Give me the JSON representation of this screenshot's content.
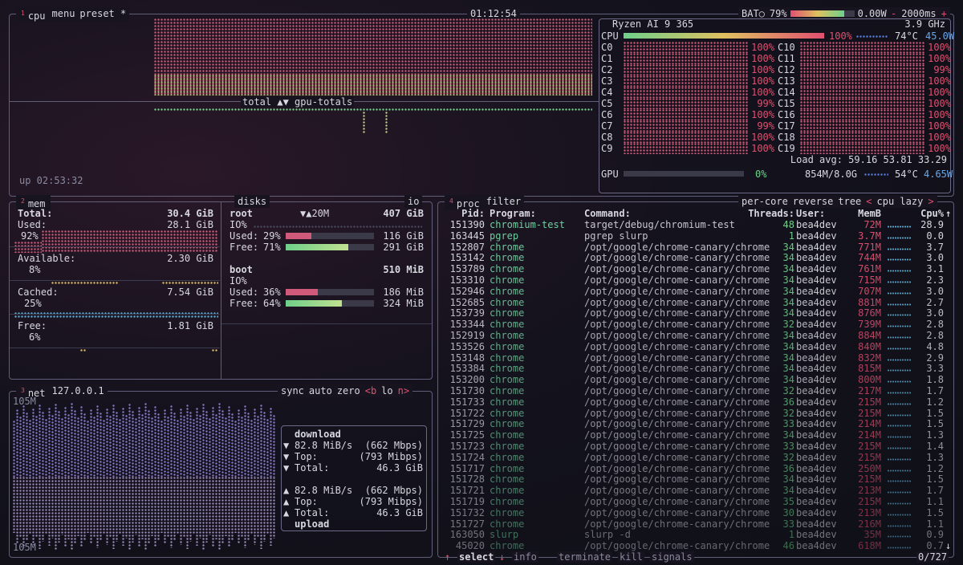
{
  "cpu": {
    "title": "cpu",
    "num": "1",
    "menu": "menu",
    "preset": "preset *",
    "clock": "01:12:54",
    "battery_label": "BAT○",
    "battery_pct": "79%",
    "battery_fraction": 0.79,
    "power": "0.00W",
    "refresh": "2000ms",
    "refresh_minus": "-",
    "refresh_plus": "+",
    "graph_label": "total ▲▼ gpu-totals",
    "uptime": "up 02:53:32",
    "model": "Ryzen AI 9 365",
    "freq": "3.9 GHz",
    "total_label": "CPU",
    "total_pct": "100%",
    "total_fraction": 1.0,
    "temp": "74°C",
    "watts": "45.0W",
    "cores_left": [
      {
        "name": "C0",
        "pct": "100%"
      },
      {
        "name": "C1",
        "pct": "100%"
      },
      {
        "name": "C2",
        "pct": "100%"
      },
      {
        "name": "C3",
        "pct": "100%"
      },
      {
        "name": "C4",
        "pct": "100%"
      },
      {
        "name": "C5",
        "pct": "99%"
      },
      {
        "name": "C6",
        "pct": "100%"
      },
      {
        "name": "C7",
        "pct": "99%"
      },
      {
        "name": "C8",
        "pct": "100%"
      },
      {
        "name": "C9",
        "pct": "100%"
      }
    ],
    "cores_right": [
      {
        "name": "C10",
        "pct": "100%"
      },
      {
        "name": "C11",
        "pct": "100%"
      },
      {
        "name": "C12",
        "pct": "99%"
      },
      {
        "name": "C13",
        "pct": "100%"
      },
      {
        "name": "C14",
        "pct": "100%"
      },
      {
        "name": "C15",
        "pct": "100%"
      },
      {
        "name": "C16",
        "pct": "100%"
      },
      {
        "name": "C17",
        "pct": "100%"
      },
      {
        "name": "C18",
        "pct": "100%"
      },
      {
        "name": "C19",
        "pct": "100%"
      }
    ],
    "load_avg": "Load avg: 59.16 53.81 33.29",
    "gpu_label": "GPU",
    "gpu_pct": "0%",
    "gpu_fraction": 0.0,
    "gpu_mem": "854M/8.0G",
    "gpu_temp": "54°C",
    "gpu_watts": "4.65W"
  },
  "mem": {
    "title": "mem",
    "num": "2",
    "total_label": "Total:",
    "total": "30.4 GiB",
    "used_label": "Used:",
    "used": "28.1 GiB",
    "used_pct": "92%",
    "avail_label": "Available:",
    "avail": "2.30 GiB",
    "avail_pct": "8%",
    "cached_label": "Cached:",
    "cached": "7.54 GiB",
    "cached_pct": "25%",
    "free_label": "Free:",
    "free": "1.81 GiB",
    "free_pct": "6%"
  },
  "disks": {
    "title": "disks",
    "io": "io",
    "root": {
      "name": "root",
      "io_rate": "▼▲20M",
      "size": "407 GiB",
      "io_label": "IO%",
      "used_label": "Used:",
      "used_pct": "29%",
      "used_fraction": 0.29,
      "used": "116 GiB",
      "free_label": "Free:",
      "free_pct": "71%",
      "free_fraction": 0.71,
      "free": "291 GiB"
    },
    "boot": {
      "name": "boot",
      "size": "510 MiB",
      "io_label": "IO%",
      "used_label": "Used:",
      "used_pct": "36%",
      "used_fraction": 0.36,
      "used": "186 MiB",
      "free_label": "Free:",
      "free_pct": "64%",
      "free_fraction": 0.64,
      "free": "324 MiB"
    }
  },
  "net": {
    "title": "net",
    "num": "3",
    "iface": "127.0.0.1",
    "sync": "sync",
    "auto": "auto",
    "zero": "zero",
    "prev": "<b",
    "lo": "lo",
    "next": "n>",
    "scale_top": "105M",
    "scale_bottom": "105M",
    "download_label": "download",
    "upload_label": "upload",
    "down_rate": "82.8 MiB/s",
    "down_mbps": "(662 Mbps)",
    "down_top_label": "Top:",
    "down_top": "(793 Mibps)",
    "down_total_label": "Total:",
    "down_total": "46.3 GiB",
    "up_rate": "82.8 MiB/s",
    "up_mbps": "(662 Mbps)",
    "up_top_label": "Top:",
    "up_top": "(793 Mibps)",
    "up_total_label": "Total:",
    "up_total": "46.3 GiB"
  },
  "proc": {
    "title": "proc",
    "num": "4",
    "filter": "filter",
    "per_core": "per-core",
    "reverse": "reverse",
    "tree": "tree",
    "sort_prev": "<",
    "sort": "cpu lazy",
    "sort_next": ">",
    "headers": {
      "pid": "Pid:",
      "program": "Program:",
      "command": "Command:",
      "threads": "Threads:",
      "user": "User:",
      "mem": "MemB",
      "cpu": "Cpu%"
    },
    "rows": [
      {
        "pid": "151390",
        "program": "chromium-test",
        "command": "target/debug/chromium-test",
        "threads": "48",
        "user": "bea4dev",
        "mem": "72M",
        "cpu": "28.9"
      },
      {
        "pid": "163445",
        "program": "pgrep",
        "command": "pgrep slurp",
        "threads": "1",
        "user": "bea4dev",
        "mem": "3.7M",
        "cpu": "0.0"
      },
      {
        "pid": "152807",
        "program": "chrome",
        "command": "/opt/google/chrome-canary/chrome",
        "threads": "34",
        "user": "bea4dev",
        "mem": "771M",
        "cpu": "3.7"
      },
      {
        "pid": "153142",
        "program": "chrome",
        "command": "/opt/google/chrome-canary/chrome",
        "threads": "34",
        "user": "bea4dev",
        "mem": "744M",
        "cpu": "3.0"
      },
      {
        "pid": "153789",
        "program": "chrome",
        "command": "/opt/google/chrome-canary/chrome",
        "threads": "34",
        "user": "bea4dev",
        "mem": "761M",
        "cpu": "3.1"
      },
      {
        "pid": "153310",
        "program": "chrome",
        "command": "/opt/google/chrome-canary/chrome",
        "threads": "34",
        "user": "bea4dev",
        "mem": "715M",
        "cpu": "2.3"
      },
      {
        "pid": "152946",
        "program": "chrome",
        "command": "/opt/google/chrome-canary/chrome",
        "threads": "34",
        "user": "bea4dev",
        "mem": "707M",
        "cpu": "3.0"
      },
      {
        "pid": "152685",
        "program": "chrome",
        "command": "/opt/google/chrome-canary/chrome",
        "threads": "34",
        "user": "bea4dev",
        "mem": "881M",
        "cpu": "2.7"
      },
      {
        "pid": "153739",
        "program": "chrome",
        "command": "/opt/google/chrome-canary/chrome",
        "threads": "34",
        "user": "bea4dev",
        "mem": "876M",
        "cpu": "3.0"
      },
      {
        "pid": "153344",
        "program": "chrome",
        "command": "/opt/google/chrome-canary/chrome",
        "threads": "32",
        "user": "bea4dev",
        "mem": "739M",
        "cpu": "2.8"
      },
      {
        "pid": "152919",
        "program": "chrome",
        "command": "/opt/google/chrome-canary/chrome",
        "threads": "34",
        "user": "bea4dev",
        "mem": "884M",
        "cpu": "2.8"
      },
      {
        "pid": "153526",
        "program": "chrome",
        "command": "/opt/google/chrome-canary/chrome",
        "threads": "34",
        "user": "bea4dev",
        "mem": "840M",
        "cpu": "4.8"
      },
      {
        "pid": "153148",
        "program": "chrome",
        "command": "/opt/google/chrome-canary/chrome",
        "threads": "34",
        "user": "bea4dev",
        "mem": "832M",
        "cpu": "2.9"
      },
      {
        "pid": "153384",
        "program": "chrome",
        "command": "/opt/google/chrome-canary/chrome",
        "threads": "34",
        "user": "bea4dev",
        "mem": "815M",
        "cpu": "3.3"
      },
      {
        "pid": "153200",
        "program": "chrome",
        "command": "/opt/google/chrome-canary/chrome",
        "threads": "34",
        "user": "bea4dev",
        "mem": "800M",
        "cpu": "1.8"
      },
      {
        "pid": "151730",
        "program": "chrome",
        "command": "/opt/google/chrome-canary/chrome",
        "threads": "32",
        "user": "bea4dev",
        "mem": "217M",
        "cpu": "1.7"
      },
      {
        "pid": "151733",
        "program": "chrome",
        "command": "/opt/google/chrome-canary/chrome",
        "threads": "36",
        "user": "bea4dev",
        "mem": "215M",
        "cpu": "1.2"
      },
      {
        "pid": "151722",
        "program": "chrome",
        "command": "/opt/google/chrome-canary/chrome",
        "threads": "32",
        "user": "bea4dev",
        "mem": "215M",
        "cpu": "1.5"
      },
      {
        "pid": "151729",
        "program": "chrome",
        "command": "/opt/google/chrome-canary/chrome",
        "threads": "33",
        "user": "bea4dev",
        "mem": "214M",
        "cpu": "1.5"
      },
      {
        "pid": "151725",
        "program": "chrome",
        "command": "/opt/google/chrome-canary/chrome",
        "threads": "34",
        "user": "bea4dev",
        "mem": "214M",
        "cpu": "1.3"
      },
      {
        "pid": "151723",
        "program": "chrome",
        "command": "/opt/google/chrome-canary/chrome",
        "threads": "33",
        "user": "bea4dev",
        "mem": "215M",
        "cpu": "1.4"
      },
      {
        "pid": "151724",
        "program": "chrome",
        "command": "/opt/google/chrome-canary/chrome",
        "threads": "32",
        "user": "bea4dev",
        "mem": "215M",
        "cpu": "1.3"
      },
      {
        "pid": "151717",
        "program": "chrome",
        "command": "/opt/google/chrome-canary/chrome",
        "threads": "36",
        "user": "bea4dev",
        "mem": "250M",
        "cpu": "1.2"
      },
      {
        "pid": "151728",
        "program": "chrome",
        "command": "/opt/google/chrome-canary/chrome",
        "threads": "34",
        "user": "bea4dev",
        "mem": "215M",
        "cpu": "1.5"
      },
      {
        "pid": "151721",
        "program": "chrome",
        "command": "/opt/google/chrome-canary/chrome",
        "threads": "34",
        "user": "bea4dev",
        "mem": "213M",
        "cpu": "1.7"
      },
      {
        "pid": "151719",
        "program": "chrome",
        "command": "/opt/google/chrome-canary/chrome",
        "threads": "35",
        "user": "bea4dev",
        "mem": "215M",
        "cpu": "1.1"
      },
      {
        "pid": "151732",
        "program": "chrome",
        "command": "/opt/google/chrome-canary/chrome",
        "threads": "30",
        "user": "bea4dev",
        "mem": "213M",
        "cpu": "1.5"
      },
      {
        "pid": "151727",
        "program": "chrome",
        "command": "/opt/google/chrome-canary/chrome",
        "threads": "33",
        "user": "bea4dev",
        "mem": "216M",
        "cpu": "1.1"
      },
      {
        "pid": "163050",
        "program": "slurp",
        "command": "slurp -d",
        "threads": "1",
        "user": "bea4dev",
        "mem": "35M",
        "cpu": "0.9"
      },
      {
        "pid": "45020",
        "program": "chrome",
        "command": "/opt/google/chrome-canary/chrome",
        "threads": "46",
        "user": "bea4dev",
        "mem": "618M",
        "cpu": "0.7"
      }
    ],
    "footer": {
      "select": "select",
      "info": "info",
      "terminate": "terminate",
      "kill": "kill",
      "signals": "signals",
      "count": "0/727",
      "arrow_up": "↑",
      "arrow_down": "↓"
    }
  }
}
